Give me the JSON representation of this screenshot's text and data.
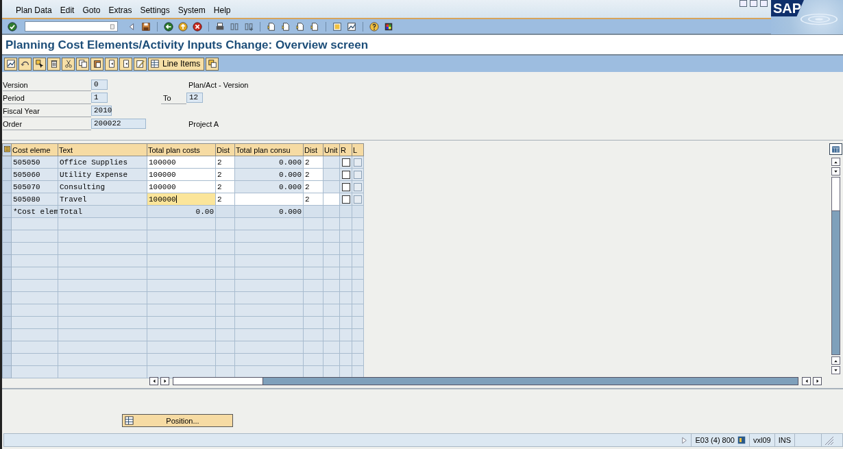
{
  "menu": [
    "Plan Data",
    "Edit",
    "Goto",
    "Extras",
    "Settings",
    "System",
    "Help"
  ],
  "logo": "SAP",
  "title": "Planning Cost Elements/Activity Inputs Change: Overview screen",
  "app_toolbar": {
    "button": "Line Items"
  },
  "header": [
    {
      "label": "Version",
      "value": "0",
      "note": "Plan/Act - Version"
    },
    {
      "label": "Period",
      "value": "1",
      "to_label": "To",
      "to_value": "12"
    },
    {
      "label": "Fiscal Year",
      "value": "2010"
    },
    {
      "label": "Order",
      "value": "200022",
      "note": "Project A"
    }
  ],
  "table": {
    "columns": [
      "Cost eleme",
      "Text",
      "Total plan costs",
      "Dist",
      "Total plan consu",
      "Dist",
      "Unit",
      "R",
      "L"
    ],
    "rows": [
      {
        "kind": "item",
        "cells": [
          {
            "text": "505050",
            "input": false
          },
          {
            "text": "Office Supplies",
            "input": false
          },
          {
            "text": "100000",
            "input": true,
            "focused": false
          },
          {
            "text": "2",
            "input": true,
            "focused": false
          },
          {
            "text": "0.000",
            "input": false
          },
          {
            "text": "2",
            "input": true,
            "focused": false
          },
          {}
        ],
        "r": {
          "checked": false
        },
        "l": {
          "checked": false,
          "disabled": true
        }
      },
      {
        "kind": "item",
        "cells": [
          {
            "text": "505060",
            "input": false
          },
          {
            "text": "Utility Expense",
            "input": false
          },
          {
            "text": "100000",
            "input": true,
            "focused": false
          },
          {
            "text": "2",
            "input": true,
            "focused": false
          },
          {
            "text": "0.000",
            "input": false
          },
          {
            "text": "2",
            "input": true,
            "focused": false
          },
          {}
        ],
        "r": {
          "checked": false
        },
        "l": {
          "checked": false,
          "disabled": true
        }
      },
      {
        "kind": "item",
        "cells": [
          {
            "text": "505070",
            "input": false
          },
          {
            "text": "Consulting",
            "input": false
          },
          {
            "text": "100000",
            "input": true,
            "focused": false
          },
          {
            "text": "2",
            "input": true,
            "focused": false
          },
          {
            "text": "0.000",
            "input": false
          },
          {
            "text": "2",
            "input": true,
            "focused": false
          },
          {}
        ],
        "r": {
          "checked": false
        },
        "l": {
          "checked": false,
          "disabled": true
        }
      },
      {
        "kind": "item",
        "cells": [
          {
            "text": "505080",
            "input": false
          },
          {
            "text": "Travel",
            "input": false
          },
          {
            "text": "100000",
            "input": true,
            "focused": true
          },
          {
            "text": "2",
            "input": true,
            "focused": false
          },
          {
            "input": true,
            "focused": false
          },
          {
            "text": "2",
            "input": true,
            "focused": false
          },
          {
            "input": true,
            "focused": false
          }
        ],
        "r": {
          "checked": false
        },
        "l": {
          "checked": false,
          "disabled": true
        }
      },
      {
        "kind": "total",
        "cells": [
          {
            "text": "*Cost elem",
            "input": false
          },
          {
            "text": "Total",
            "input": false
          },
          {
            "text": "0.00",
            "input": false
          },
          {},
          {
            "text": "0.000",
            "input": false
          },
          {},
          {}
        ]
      }
    ]
  },
  "position_button": "Position...",
  "status_bar": {
    "system": "E03 (4) 800",
    "server": "vxl09",
    "mode": "INS"
  }
}
